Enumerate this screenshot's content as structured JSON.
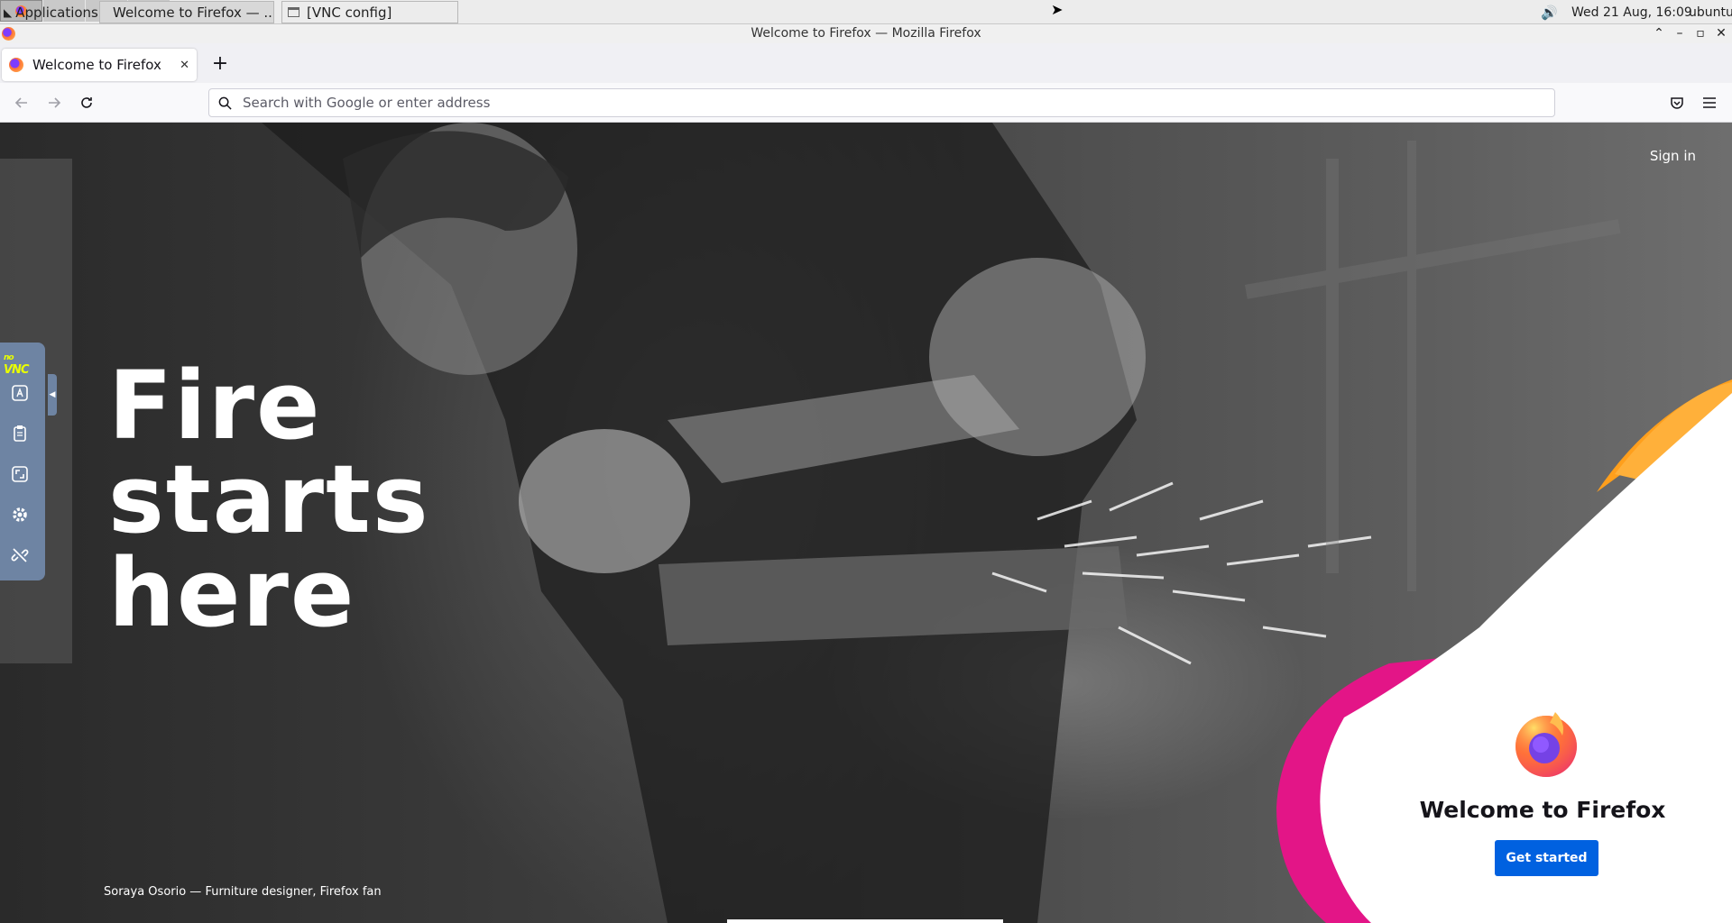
{
  "panel": {
    "apps_label": "Applications",
    "tasks": [
      {
        "label": "Welcome to Firefox — ...",
        "icon": "firefox-icon"
      },
      {
        "label": "[VNC config]",
        "icon": "window-icon"
      }
    ],
    "clock": "Wed 21 Aug, 16:09",
    "user": "ubuntu"
  },
  "window": {
    "title": "Welcome to Firefox — Mozilla Firefox"
  },
  "tab": {
    "label": "Welcome to Firefox"
  },
  "urlbar": {
    "placeholder": "Search with Google or enter address"
  },
  "content": {
    "signin": "Sign in",
    "hero_lines": [
      "Fire",
      "starts",
      "here"
    ],
    "credit": "Soraya Osorio — Furniture designer, Firefox fan",
    "welcome_title": "Welcome to Firefox",
    "get_started": "Get started"
  },
  "colors": {
    "accent_blue": "#0061e0",
    "novnc_panel": "#6e84a3",
    "swoosh_pink": "#e31587",
    "swoosh_orange": "#ff9f1c"
  }
}
